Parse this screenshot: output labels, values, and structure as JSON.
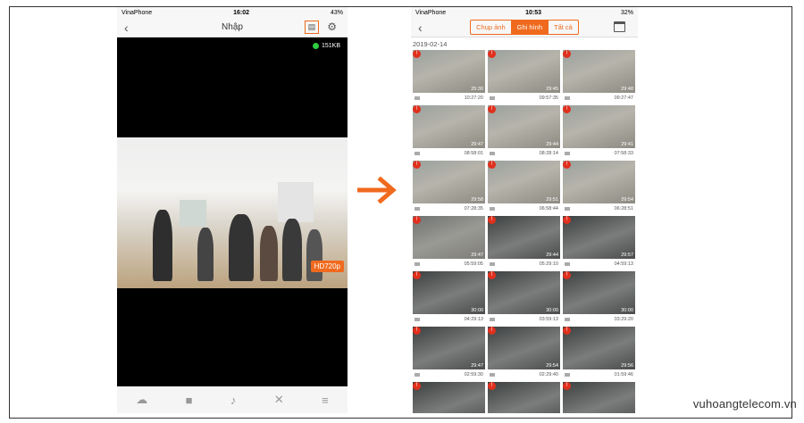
{
  "left_phone": {
    "status": {
      "carrier": "VinaPhone",
      "time": "16:02",
      "battery": "43%"
    },
    "title": "Nhập",
    "bitrate": "151KB",
    "quality_badge": "HD720p"
  },
  "right_phone": {
    "status": {
      "carrier": "VinaPhone",
      "time": "10:53",
      "battery": "32%"
    },
    "tabs": [
      "Chụp ảnh",
      "Ghi hình",
      "Tất cả"
    ],
    "active_tab": "Ghi hình",
    "date": "2019-02-14",
    "recordings": [
      {
        "dur": "25:30",
        "time": "10:27:20",
        "tone": "day"
      },
      {
        "dur": "29:45",
        "time": "09:57:35",
        "tone": "day"
      },
      {
        "dur": "29:48",
        "time": "09:27:47",
        "tone": "day"
      },
      {
        "dur": "29:47",
        "time": "08:58:01",
        "tone": "day"
      },
      {
        "dur": "29:44",
        "time": "08:28:14",
        "tone": "day"
      },
      {
        "dur": "29:41",
        "time": "07:58:33",
        "tone": "day"
      },
      {
        "dur": "29:58",
        "time": "07:28:35",
        "tone": "day"
      },
      {
        "dur": "29:51",
        "time": "06:58:44",
        "tone": "day"
      },
      {
        "dur": "29:54",
        "time": "06:28:51",
        "tone": "day"
      },
      {
        "dur": "29:47",
        "time": "05:59:05",
        "tone": "dusk"
      },
      {
        "dur": "29:44",
        "time": "05:29:10",
        "tone": "night"
      },
      {
        "dur": "29:57",
        "time": "04:59:13",
        "tone": "night"
      },
      {
        "dur": "30:00",
        "time": "04:29:13",
        "tone": "night"
      },
      {
        "dur": "30:00",
        "time": "03:59:13",
        "tone": "night"
      },
      {
        "dur": "30:00",
        "time": "03:29:20",
        "tone": "night"
      },
      {
        "dur": "29:47",
        "time": "02:59:30",
        "tone": "night"
      },
      {
        "dur": "29:54",
        "time": "02:29:40",
        "tone": "night"
      },
      {
        "dur": "29:56",
        "time": "01:59:46",
        "tone": "night"
      },
      {
        "dur": "",
        "time": "",
        "tone": "night"
      },
      {
        "dur": "",
        "time": "",
        "tone": "night"
      },
      {
        "dur": "",
        "time": "",
        "tone": "night"
      }
    ]
  },
  "watermark": "vuhoangtelecom.vn",
  "colors": {
    "accent": "#f06a1e",
    "flag": "#e0301e"
  }
}
